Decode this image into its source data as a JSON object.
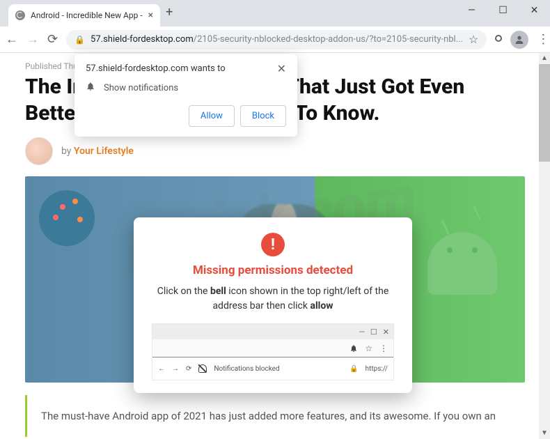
{
  "window": {
    "tab_title": "Android - Incredible New App - ",
    "min": "—",
    "max": "☐",
    "close": "✕",
    "newtab": "+"
  },
  "toolbar": {
    "back": "←",
    "forward": "→",
    "reload": "⟳",
    "lock": "🔒",
    "domain": "57.shield-fordesktop.com",
    "path": "/2105-security-nblocked-desktop-addon-us/?to=2105-security-nbl...",
    "star": "☆",
    "menu": "⋮"
  },
  "prompt": {
    "origin": "57.shield-fordesktop.com wants to",
    "action": "Show notifications",
    "allow": "Allow",
    "block": "Block",
    "close": "✕"
  },
  "page": {
    "date": "Published Thu, Jun 10th 2021",
    "headline": "The Incredible Android App That Just Got Even Better: Everything You Need To Know.",
    "by": "by",
    "author": "Your Lifestyle",
    "body": "The must-have Android app of 2021 has just added more features, and its awesome. If you own an"
  },
  "modal": {
    "icon": "!",
    "title": "Missing permissions detected",
    "text_pre": "Click on the ",
    "text_bold1": "bell",
    "text_mid": " icon shown in the top right/left of the address bar then click ",
    "text_bold2": "allow",
    "mini_notif": "Notifications blocked",
    "mini_https": "https://"
  },
  "watermark": "pcrisk.com"
}
